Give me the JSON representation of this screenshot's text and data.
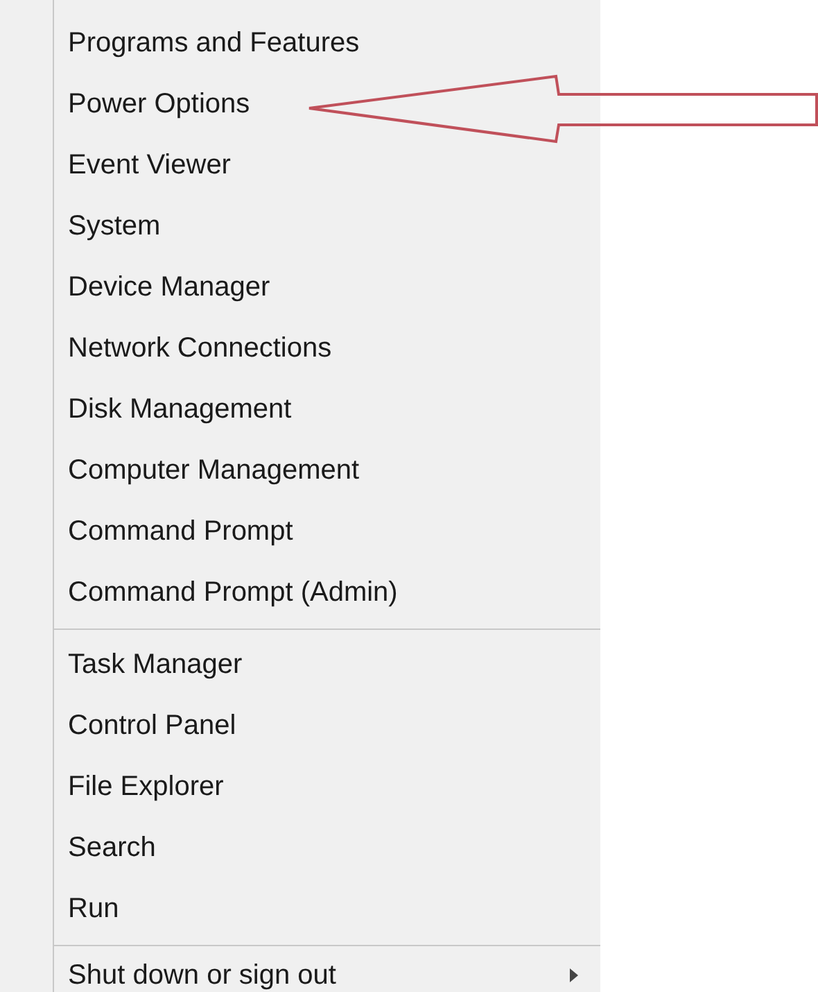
{
  "menu": {
    "groups": [
      {
        "items": [
          {
            "label": "Programs and Features",
            "submenu": false
          },
          {
            "label": "Power Options",
            "submenu": false
          },
          {
            "label": "Event Viewer",
            "submenu": false
          },
          {
            "label": "System",
            "submenu": false
          },
          {
            "label": "Device Manager",
            "submenu": false
          },
          {
            "label": "Network Connections",
            "submenu": false
          },
          {
            "label": "Disk Management",
            "submenu": false
          },
          {
            "label": "Computer Management",
            "submenu": false
          },
          {
            "label": "Command Prompt",
            "submenu": false
          },
          {
            "label": "Command Prompt (Admin)",
            "submenu": false
          }
        ]
      },
      {
        "items": [
          {
            "label": "Task Manager",
            "submenu": false
          },
          {
            "label": "Control Panel",
            "submenu": false
          },
          {
            "label": "File Explorer",
            "submenu": false
          },
          {
            "label": "Search",
            "submenu": false
          },
          {
            "label": "Run",
            "submenu": false
          }
        ]
      },
      {
        "items": [
          {
            "label": "Shut down or sign out",
            "submenu": true
          }
        ]
      }
    ]
  }
}
